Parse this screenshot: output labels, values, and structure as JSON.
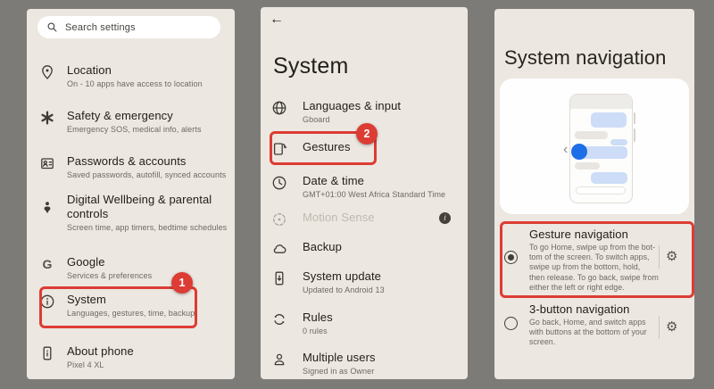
{
  "colors": {
    "outer_bg": "#7c7b78",
    "panel_bg": "#ece7e0",
    "accent_red": "#dc3c34",
    "blue_dot": "#1e6ee8",
    "bubble_blue": "#cdddf7",
    "bubble_gray": "#e9e6e2"
  },
  "panel1": {
    "search": {
      "placeholder": "Search settings",
      "icon": "magnifier"
    },
    "items": [
      {
        "icon": "location-pin",
        "title": "Location",
        "subtitle": "On - 10 apps have access to location"
      },
      {
        "icon": "medical-asterisk",
        "title": "Safety & emergency",
        "subtitle": "Emergency SOS, medical info, alerts"
      },
      {
        "icon": "contact-card",
        "title": "Passwords & accounts",
        "subtitle": "Saved passwords, autofill, synced accounts"
      },
      {
        "icon": "wellbeing-figure",
        "title": "Digital Wellbeing & parental\ncontrols",
        "subtitle": "Screen time, app timers, bedtime schedules"
      },
      {
        "icon": "google-g",
        "title": "Google",
        "subtitle": "Services & preferences"
      },
      {
        "icon": "info-circle",
        "title": "System",
        "subtitle": "Languages, gestures, time, backup",
        "step_badge": "1"
      },
      {
        "icon": "phone-info",
        "title": "About phone",
        "subtitle": "Pixel 4 XL"
      }
    ]
  },
  "panel2": {
    "back_icon": "←",
    "title": "System",
    "items": [
      {
        "icon": "globe",
        "title": "Languages & input",
        "subtitle": "Gboard"
      },
      {
        "icon": "phone-gesture",
        "title": "Gestures",
        "step_badge": "2"
      },
      {
        "icon": "clock",
        "title": "Date & time",
        "subtitle": "GMT+01:00 West Africa Standard Time"
      },
      {
        "icon": "motion-sense",
        "title": "Motion Sense",
        "disabled": true,
        "trailing_icon": "info-filled",
        "trailing_glyph": "i"
      },
      {
        "icon": "cloud-backup",
        "title": "Backup"
      },
      {
        "icon": "phone-update",
        "title": "System update",
        "subtitle": "Updated to Android 13"
      },
      {
        "icon": "rules-sync",
        "title": "Rules",
        "subtitle": "0 rules"
      },
      {
        "icon": "person",
        "title": "Multiple users",
        "subtitle": "Signed in as Owner"
      }
    ]
  },
  "panel3": {
    "title": "System navigation",
    "illustration": "phone-chat-gesture-back",
    "options": [
      {
        "title": "Gesture navigation",
        "description": "To go Home, swipe up from the bot-\ntom of the screen. To switch apps,\nswipe up from the bottom, hold,\nthen release. To go back, swipe from\neither the left or right edge.",
        "selected": true,
        "highlighted": true,
        "gear_icon": "⚙"
      },
      {
        "title": "3-button navigation",
        "description": "Go back, Home, and switch apps\nwith buttons at the bottom of your\nscreen.",
        "selected": false,
        "gear_icon": "⚙"
      }
    ]
  }
}
